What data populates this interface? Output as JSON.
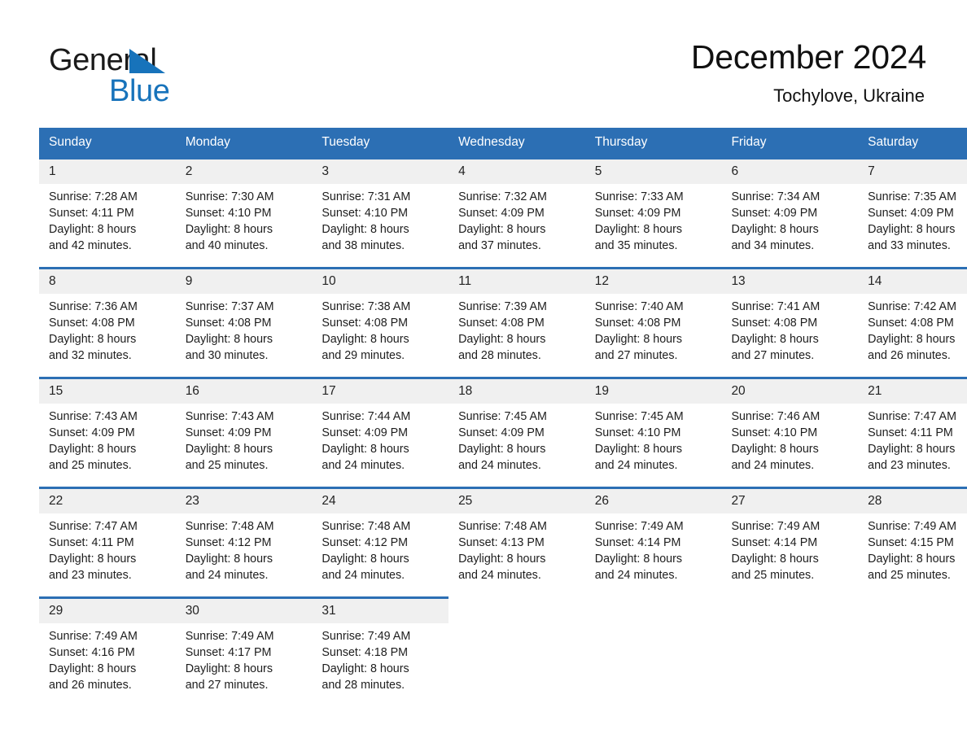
{
  "brand": {
    "name_top": "General",
    "name_bottom": "Blue",
    "accent_color": "#1773bb"
  },
  "header": {
    "title": "December 2024",
    "location": "Tochylove, Ukraine"
  },
  "theme": {
    "header_blue": "#2c6fb4",
    "daynum_gray": "#f0f0f0",
    "page_background": "#ffffff"
  },
  "calendar": {
    "weekday_headers": [
      "Sunday",
      "Monday",
      "Tuesday",
      "Wednesday",
      "Thursday",
      "Friday",
      "Saturday"
    ],
    "weeks": [
      [
        {
          "day": "1",
          "details": "Sunrise: 7:28 AM\nSunset: 4:11 PM\nDaylight: 8 hours\nand 42 minutes."
        },
        {
          "day": "2",
          "details": "Sunrise: 7:30 AM\nSunset: 4:10 PM\nDaylight: 8 hours\nand 40 minutes."
        },
        {
          "day": "3",
          "details": "Sunrise: 7:31 AM\nSunset: 4:10 PM\nDaylight: 8 hours\nand 38 minutes."
        },
        {
          "day": "4",
          "details": "Sunrise: 7:32 AM\nSunset: 4:09 PM\nDaylight: 8 hours\nand 37 minutes."
        },
        {
          "day": "5",
          "details": "Sunrise: 7:33 AM\nSunset: 4:09 PM\nDaylight: 8 hours\nand 35 minutes."
        },
        {
          "day": "6",
          "details": "Sunrise: 7:34 AM\nSunset: 4:09 PM\nDaylight: 8 hours\nand 34 minutes."
        },
        {
          "day": "7",
          "details": "Sunrise: 7:35 AM\nSunset: 4:09 PM\nDaylight: 8 hours\nand 33 minutes."
        }
      ],
      [
        {
          "day": "8",
          "details": "Sunrise: 7:36 AM\nSunset: 4:08 PM\nDaylight: 8 hours\nand 32 minutes."
        },
        {
          "day": "9",
          "details": "Sunrise: 7:37 AM\nSunset: 4:08 PM\nDaylight: 8 hours\nand 30 minutes."
        },
        {
          "day": "10",
          "details": "Sunrise: 7:38 AM\nSunset: 4:08 PM\nDaylight: 8 hours\nand 29 minutes."
        },
        {
          "day": "11",
          "details": "Sunrise: 7:39 AM\nSunset: 4:08 PM\nDaylight: 8 hours\nand 28 minutes."
        },
        {
          "day": "12",
          "details": "Sunrise: 7:40 AM\nSunset: 4:08 PM\nDaylight: 8 hours\nand 27 minutes."
        },
        {
          "day": "13",
          "details": "Sunrise: 7:41 AM\nSunset: 4:08 PM\nDaylight: 8 hours\nand 27 minutes."
        },
        {
          "day": "14",
          "details": "Sunrise: 7:42 AM\nSunset: 4:08 PM\nDaylight: 8 hours\nand 26 minutes."
        }
      ],
      [
        {
          "day": "15",
          "details": "Sunrise: 7:43 AM\nSunset: 4:09 PM\nDaylight: 8 hours\nand 25 minutes."
        },
        {
          "day": "16",
          "details": "Sunrise: 7:43 AM\nSunset: 4:09 PM\nDaylight: 8 hours\nand 25 minutes."
        },
        {
          "day": "17",
          "details": "Sunrise: 7:44 AM\nSunset: 4:09 PM\nDaylight: 8 hours\nand 24 minutes."
        },
        {
          "day": "18",
          "details": "Sunrise: 7:45 AM\nSunset: 4:09 PM\nDaylight: 8 hours\nand 24 minutes."
        },
        {
          "day": "19",
          "details": "Sunrise: 7:45 AM\nSunset: 4:10 PM\nDaylight: 8 hours\nand 24 minutes."
        },
        {
          "day": "20",
          "details": "Sunrise: 7:46 AM\nSunset: 4:10 PM\nDaylight: 8 hours\nand 24 minutes."
        },
        {
          "day": "21",
          "details": "Sunrise: 7:47 AM\nSunset: 4:11 PM\nDaylight: 8 hours\nand 23 minutes."
        }
      ],
      [
        {
          "day": "22",
          "details": "Sunrise: 7:47 AM\nSunset: 4:11 PM\nDaylight: 8 hours\nand 23 minutes."
        },
        {
          "day": "23",
          "details": "Sunrise: 7:48 AM\nSunset: 4:12 PM\nDaylight: 8 hours\nand 24 minutes."
        },
        {
          "day": "24",
          "details": "Sunrise: 7:48 AM\nSunset: 4:12 PM\nDaylight: 8 hours\nand 24 minutes."
        },
        {
          "day": "25",
          "details": "Sunrise: 7:48 AM\nSunset: 4:13 PM\nDaylight: 8 hours\nand 24 minutes."
        },
        {
          "day": "26",
          "details": "Sunrise: 7:49 AM\nSunset: 4:14 PM\nDaylight: 8 hours\nand 24 minutes."
        },
        {
          "day": "27",
          "details": "Sunrise: 7:49 AM\nSunset: 4:14 PM\nDaylight: 8 hours\nand 25 minutes."
        },
        {
          "day": "28",
          "details": "Sunrise: 7:49 AM\nSunset: 4:15 PM\nDaylight: 8 hours\nand 25 minutes."
        }
      ],
      [
        {
          "day": "29",
          "details": "Sunrise: 7:49 AM\nSunset: 4:16 PM\nDaylight: 8 hours\nand 26 minutes."
        },
        {
          "day": "30",
          "details": "Sunrise: 7:49 AM\nSunset: 4:17 PM\nDaylight: 8 hours\nand 27 minutes."
        },
        {
          "day": "31",
          "details": "Sunrise: 7:49 AM\nSunset: 4:18 PM\nDaylight: 8 hours\nand 28 minutes."
        },
        {
          "day": "",
          "details": ""
        },
        {
          "day": "",
          "details": ""
        },
        {
          "day": "",
          "details": ""
        },
        {
          "day": "",
          "details": ""
        }
      ]
    ]
  }
}
